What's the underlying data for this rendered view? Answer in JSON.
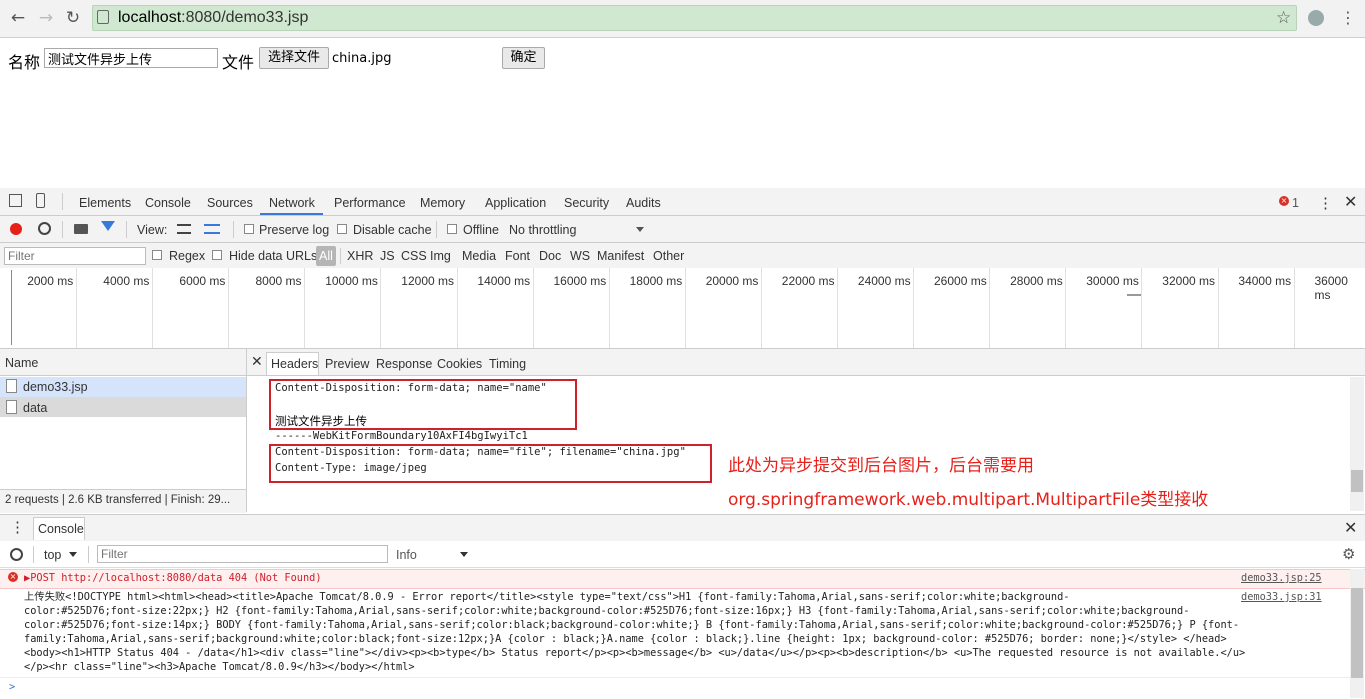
{
  "browser": {
    "url_host": "localhost",
    "url_rest": ":8080/demo33.jsp"
  },
  "page": {
    "name_label": "名称",
    "name_value": "测试文件异步上传",
    "file_label": "文件",
    "choose_file_label": "选择文件",
    "chosen_file": "china.jpg",
    "submit_label": "确定"
  },
  "devtools": {
    "tabs": [
      "Elements",
      "Console",
      "Sources",
      "Network",
      "Performance",
      "Memory",
      "Application",
      "Security",
      "Audits"
    ],
    "active_tab": "Network",
    "error_count": "1",
    "toolbar": {
      "view_label": "View:",
      "preserve_log": "Preserve log",
      "disable_cache": "Disable cache",
      "offline": "Offline",
      "throttling": "No throttling"
    },
    "filter": {
      "placeholder": "Filter",
      "regex": "Regex",
      "hide_data_urls": "Hide data URLs",
      "types": [
        "All",
        "XHR",
        "JS",
        "CSS",
        "Img",
        "Media",
        "Font",
        "Doc",
        "WS",
        "Manifest",
        "Other"
      ]
    },
    "timeline_ticks": [
      "2000 ms",
      "4000 ms",
      "6000 ms",
      "8000 ms",
      "10000 ms",
      "12000 ms",
      "14000 ms",
      "16000 ms",
      "18000 ms",
      "20000 ms",
      "22000 ms",
      "24000 ms",
      "26000 ms",
      "28000 ms",
      "30000 ms",
      "32000 ms",
      "34000 ms",
      "36000 ms"
    ],
    "requests": {
      "header": "Name",
      "items": [
        "demo33.jsp",
        "data"
      ],
      "summary": "2 requests | 2.6 KB transferred | Finish: 29..."
    },
    "detail_tabs": [
      "Headers",
      "Preview",
      "Response",
      "Cookies",
      "Timing"
    ],
    "payload": {
      "line1": "Content-Disposition: form-data; name=\"name\"",
      "line2": "测试文件异步上传",
      "line3": "------WebKitFormBoundary10AxFI4bgIwyiTc1",
      "line4": "Content-Disposition: form-data; name=\"file\"; filename=\"china.jpg\"",
      "line5": "Content-Type: image/jpeg"
    },
    "annotation": {
      "line1": "此处为异步提交到后台图片，后台需要用",
      "line2": "org.springframework.web.multipart.MultipartFile类型接收"
    },
    "console": {
      "tab": "Console",
      "context": "top",
      "filter_placeholder": "Filter",
      "level": "Info",
      "error_line": "▶POST http://localhost:8080/data 404 (Not Found)",
      "error_source": "demo33.jsp:25",
      "log_source": "demo33.jsp:31",
      "log_lines": [
        "上传失败<!DOCTYPE html><html><head><title>Apache Tomcat/8.0.9 - Error report</title><style type=\"text/css\">H1 {font-family:Tahoma,Arial,sans-serif;color:white;background-",
        "color:#525D76;font-size:22px;} H2 {font-family:Tahoma,Arial,sans-serif;color:white;background-color:#525D76;font-size:16px;} H3 {font-family:Tahoma,Arial,sans-serif;color:white;background-",
        "color:#525D76;font-size:14px;} BODY {font-family:Tahoma,Arial,sans-serif;color:black;background-color:white;} B {font-family:Tahoma,Arial,sans-serif;color:white;background-color:#525D76;} P {font-",
        "family:Tahoma,Arial,sans-serif;background:white;color:black;font-size:12px;}A {color : black;}A.name {color : black;}.line {height: 1px; background-color: #525D76; border: none;}</style> </head>",
        "<body><h1>HTTP Status 404 - /data</h1><div class=\"line\"></div><p><b>type</b> Status report</p><p><b>message</b> <u>/data</u></p><p><b>description</b> <u>The requested resource is not available.</u>",
        "</p><hr class=\"line\"><h3>Apache Tomcat/8.0.9</h3></body></html>"
      ],
      "prompt": ">"
    }
  }
}
